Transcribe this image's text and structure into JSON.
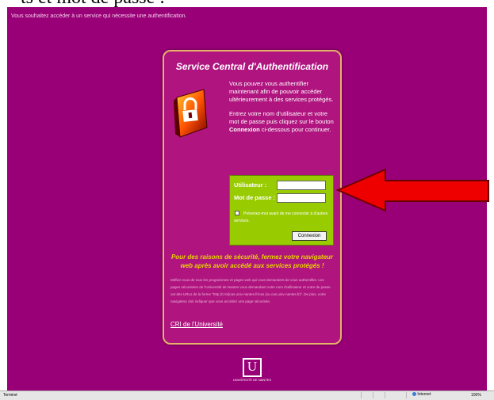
{
  "header": {
    "overflow_text": "ts et mot de passe :"
  },
  "page": {
    "intro": "Vous souhaitez accéder à un service qui nécessite une authentification.",
    "card": {
      "title": "Service Central d'Authentification",
      "desc_p1": "Vous pouvez vous authentifier maintenant afin de pouvoir accéder ultérieurement à des services protégés.",
      "desc_p2_pre": "Entrez votre nom d'utilisateur et votre mot de passe puis cliquez sur le bouton ",
      "desc_p2_bold": "Connexion",
      "desc_p2_post": " ci-dessous pour continuer.",
      "login": {
        "user_label": "Utilisateur :",
        "password_label": "Mot de passe :",
        "user_value": "",
        "password_value": "",
        "warn_label": "Prévenez-moi avant de me connecter à d'autres services.",
        "button_label": "Connexion"
      },
      "security_warning": "Pour des raisons de sécurité, fermez votre navigateur web après avoir accédé aux services protégés !",
      "small_text": "Méfiez-vous de tous les programmes et pages web qui vous demandent de vous authentifier. Les pages sécurisées de l'Université de Nantes vous demandant votre nom d'utilisateur et votre de passe ont des URLs de la forme \"http [CAS]cas.univ-nantes.fr/cas (ou cas.univ-nantes.fr)\". De plus, votre navigateur doit indiquer que vous accédez une page sécurisée.",
      "cri_link": "CRI de l'Université"
    },
    "logo_letter": "U",
    "logo_text": "UNIVERSITÉ DE NANTES"
  },
  "status_bar": {
    "left": "Terminé",
    "zone": "Internet",
    "zoom": "100%"
  },
  "colors": {
    "page_bg": "#990077",
    "card_bg": "#b0147f",
    "login_box": "#99cc00",
    "warning_text": "#e8d400",
    "arrow": "#ee0000"
  },
  "icons": [
    "padlock-icon",
    "red-arrow-icon",
    "internet-zone-icon"
  ]
}
